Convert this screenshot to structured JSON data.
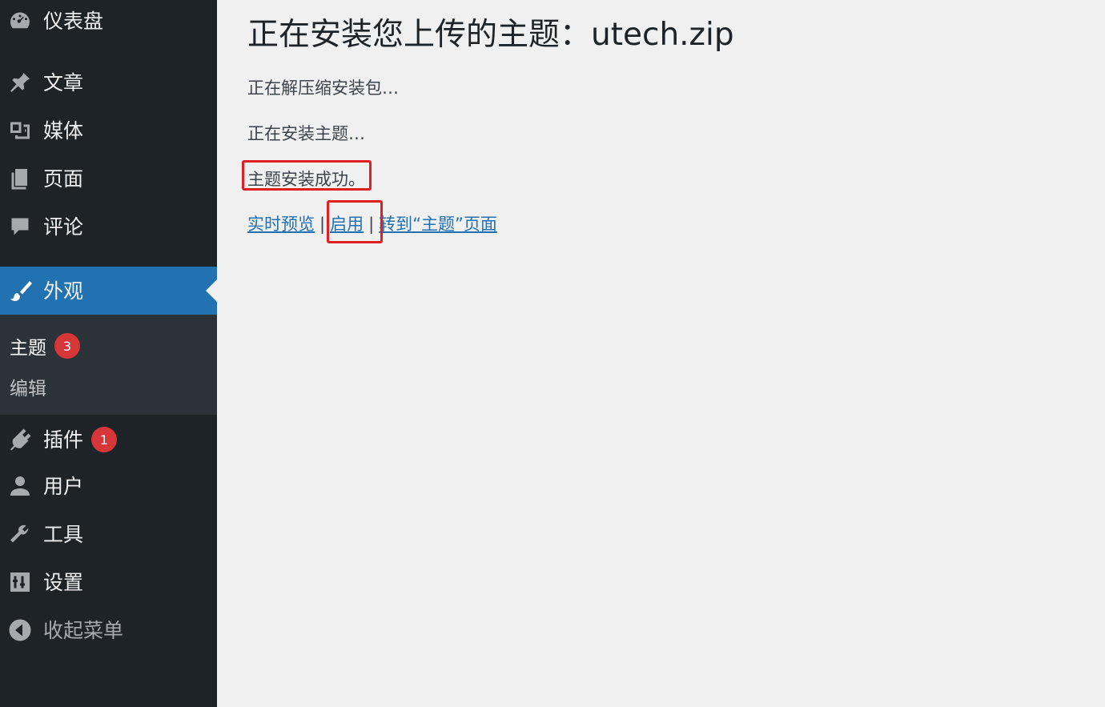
{
  "sidebar": {
    "items": [
      {
        "label": "仪表盘",
        "icon": "dashboard-icon"
      },
      {
        "label": "文章",
        "icon": "pin-icon"
      },
      {
        "label": "媒体",
        "icon": "media-icon"
      },
      {
        "label": "页面",
        "icon": "pages-icon"
      },
      {
        "label": "评论",
        "icon": "comment-icon"
      },
      {
        "label": "外观",
        "icon": "paintbrush-icon",
        "active": true
      },
      {
        "label": "插件",
        "icon": "plugin-icon",
        "badge": "1"
      },
      {
        "label": "用户",
        "icon": "user-icon"
      },
      {
        "label": "工具",
        "icon": "wrench-icon"
      },
      {
        "label": "设置",
        "icon": "settings-icon"
      },
      {
        "label": "收起菜单",
        "icon": "collapse-icon"
      }
    ],
    "submenu": [
      {
        "label": "主题",
        "badge": "3"
      },
      {
        "label": "编辑"
      }
    ]
  },
  "main": {
    "title": "正在安装您上传的主题：utech.zip",
    "steps": [
      "正在解压缩安装包…",
      "正在安装主题…",
      "主题安装成功。"
    ],
    "links": {
      "live_preview": "实时预览",
      "activate": "启用",
      "goto_themes": "转到“主题”页面",
      "separator": "|"
    }
  },
  "colors": {
    "sidebar_bg": "#1d2327",
    "submenu_bg": "#2c3338",
    "active_bg": "#2271b1",
    "badge": "#d63638",
    "link": "#2271b1",
    "highlight_box": "#e02020",
    "content_bg": "#f0f0f1"
  }
}
